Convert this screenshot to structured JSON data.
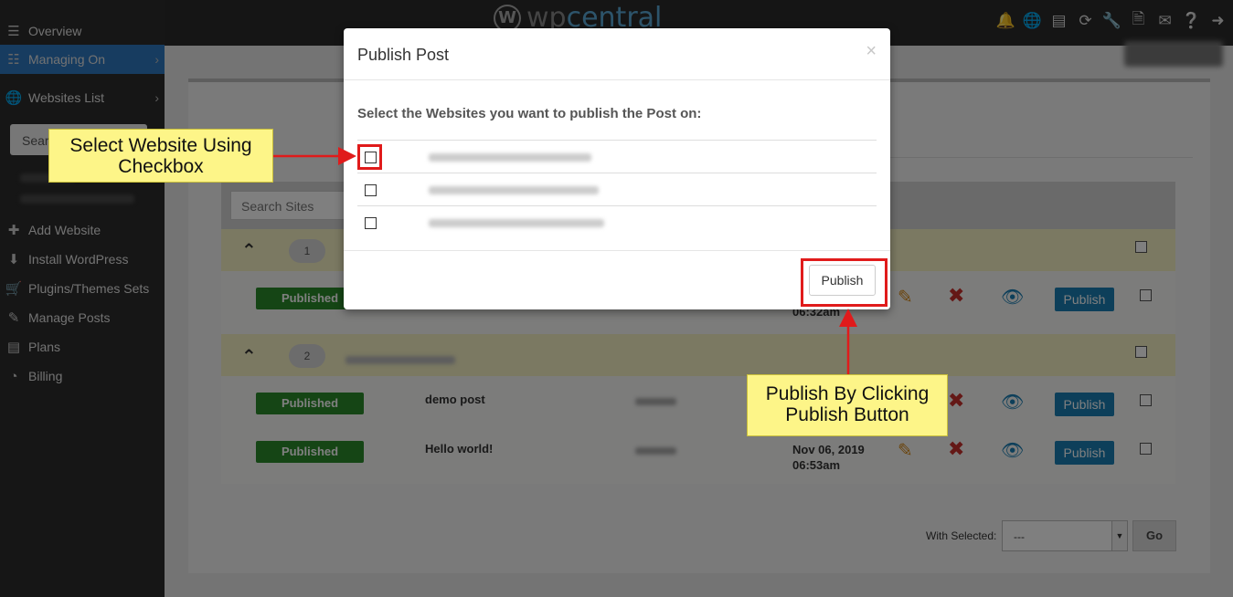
{
  "app": {
    "logo_wp": "wp",
    "logo_central": "central"
  },
  "topbar_icons": [
    "bell-icon",
    "globe-icon",
    "archive-icon",
    "refresh-icon",
    "wrench-icon",
    "file-icon",
    "envelope-icon",
    "help-icon",
    "logout-icon"
  ],
  "sidebar": {
    "items": [
      {
        "label": "Overview",
        "icon": "layers-icon"
      },
      {
        "label": "Managing On",
        "icon": "server-icon"
      },
      {
        "label": "Websites List",
        "icon": "globe-icon"
      },
      {
        "label": "Add Website",
        "icon": "plus-icon"
      },
      {
        "label": "Install WordPress",
        "icon": "download-icon"
      },
      {
        "label": "Plugins/Themes Sets",
        "icon": "cart-icon"
      },
      {
        "label": "Manage Posts",
        "icon": "pencil-icon"
      },
      {
        "label": "Plans",
        "icon": "list-icon"
      },
      {
        "label": "Billing",
        "icon": "pie-icon"
      }
    ],
    "search_placeholder": "Sear"
  },
  "content": {
    "search_sites_placeholder": "Search Sites",
    "groups": [
      {
        "number": "1",
        "rows": [
          {
            "status": "Published",
            "title": "",
            "date_line1": "",
            "date_line2": "06:32am",
            "action_label": "Publish"
          }
        ]
      },
      {
        "number": "2",
        "rows": [
          {
            "status": "Published",
            "title": "demo post",
            "date_line1": "",
            "date_line2": "",
            "action_label": "Publish"
          },
          {
            "status": "Published",
            "title": "Hello world!",
            "date_line1": "Nov 06, 2019",
            "date_line2": "06:53am",
            "action_label": "Publish"
          }
        ]
      }
    ],
    "bulk": {
      "label": "With Selected:",
      "select_value": "---",
      "go_label": "Go"
    }
  },
  "modal": {
    "title": "Publish Post",
    "close": "×",
    "question": "Select the Websites you want to publish the Post on:",
    "sites": [
      {
        "checked": false
      },
      {
        "checked": false
      },
      {
        "checked": false
      }
    ],
    "publish_label": "Publish"
  },
  "annotations": {
    "checkbox_tip_line1": "Select Website Using",
    "checkbox_tip_line2": "Checkbox",
    "publish_tip_line1": "Publish By Clicking",
    "publish_tip_line2": "Publish Button",
    "highlight_color": "#e01b1b",
    "callout_color": "#fdf588"
  }
}
